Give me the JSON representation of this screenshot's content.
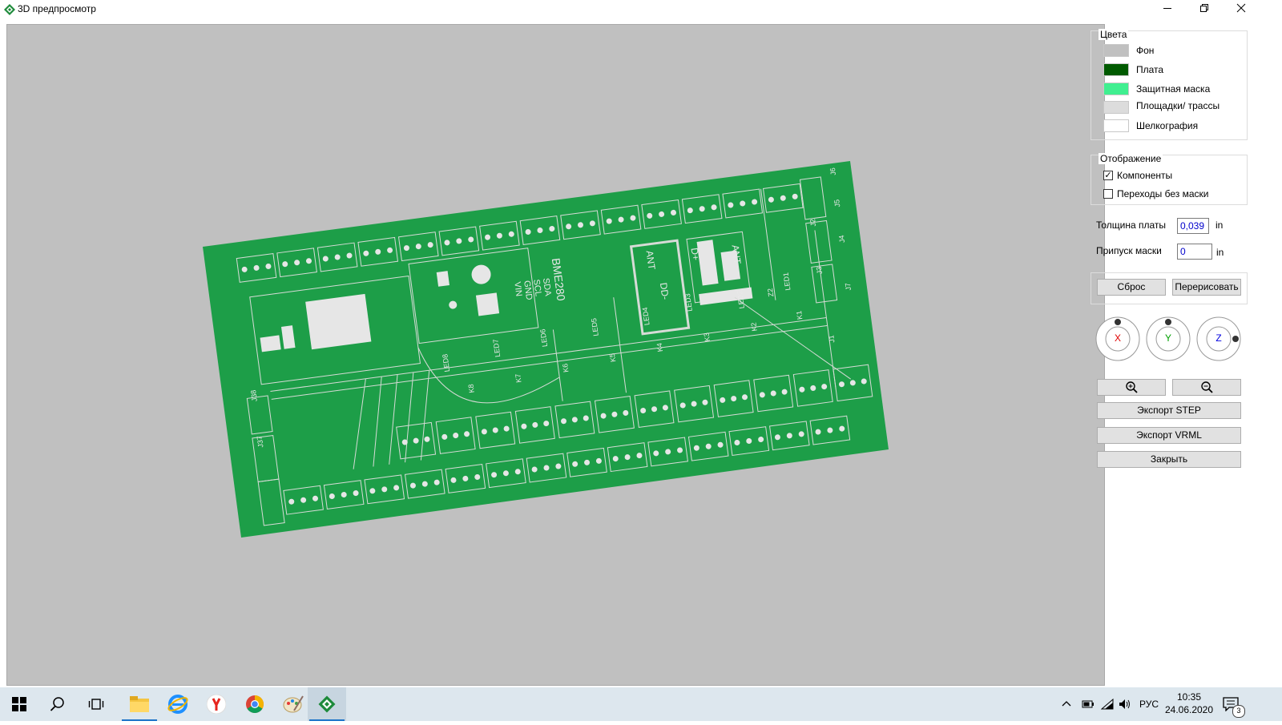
{
  "window": {
    "title": "3D предпросмотр"
  },
  "colors_group": {
    "title": "Цвета",
    "items": [
      {
        "label": "Фон",
        "color": "#c0c0c0"
      },
      {
        "label": "Плата",
        "color": "#005a00"
      },
      {
        "label": "Защитная маска",
        "color": "#40ef90"
      },
      {
        "label": "Площадки/ трассы",
        "color": "#dcdcdc"
      },
      {
        "label": "Шелкография",
        "color": "#ffffff"
      }
    ]
  },
  "display_group": {
    "title": "Отображение",
    "components": {
      "label": "Компоненты",
      "checked": true
    },
    "vias_no_mask": {
      "label": "Переходы без маски",
      "checked": false
    }
  },
  "board": {
    "thickness_label": "Толщина платы",
    "thickness_value": "0,039",
    "thickness_unit": "in",
    "mask_margin_label": "Припуск маски",
    "mask_margin_value": "0",
    "mask_margin_unit": "in"
  },
  "buttons": {
    "reset": "Сброс",
    "redraw": "Перерисовать",
    "export_step": "Экспорт STEP",
    "export_vrml": "Экспорт VRML",
    "close": "Закрыть"
  },
  "rotation": {
    "x": "X",
    "y": "Y",
    "z": "Z"
  },
  "pcb_labels": [
    "BME280",
    "ANT",
    "ANT",
    "D+",
    "DD-",
    "J38",
    "J37",
    "LED1",
    "LED2",
    "LED3",
    "LED4",
    "LED5",
    "LED6",
    "LED7",
    "LED8",
    "K1",
    "K2",
    "K3",
    "K4",
    "K5",
    "K6",
    "K7",
    "K8",
    "J1",
    "J2",
    "J3",
    "J4",
    "J5",
    "J6",
    "J7",
    "Z2",
    "VIN",
    "GND",
    "SCL",
    "SDA"
  ],
  "taskbar": {
    "language": "РУС",
    "time": "10:35",
    "date": "24.06.2020",
    "notifications": "3"
  },
  "theme": {
    "pcb_green": "#1d9e48",
    "viewport_bg": "#c0c0c0",
    "accent": "#1a73c8"
  }
}
